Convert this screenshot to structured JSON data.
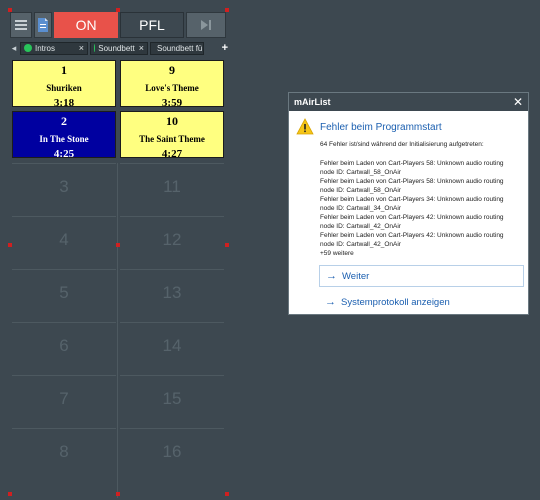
{
  "toolbar": {
    "on_label": "ON",
    "pfl_label": "PFL"
  },
  "tabs": [
    {
      "label": "Intros",
      "close": "×"
    },
    {
      "label": "Soundbett",
      "close": "×"
    },
    {
      "label": "Soundbett fü",
      "close": ""
    }
  ],
  "tab_add": "+",
  "tab_prev": "◂",
  "carts": [
    {
      "number": "1",
      "title": "Shuriken",
      "duration": "3:18",
      "color": "#ffff80"
    },
    {
      "number": "9",
      "title": "Love's Theme",
      "duration": "3:59",
      "color": "#ffff80"
    },
    {
      "number": "2",
      "title": "In The Stone",
      "duration": "4:25",
      "color": "#0000a0"
    },
    {
      "number": "10",
      "title": "The Saint Theme",
      "duration": "4:27",
      "color": "#ffff80"
    }
  ],
  "empty_slots": [
    "3",
    "11",
    "4",
    "12",
    "5",
    "13",
    "6",
    "14",
    "7",
    "15",
    "8",
    "16"
  ],
  "dialog": {
    "window_title": "mAirList",
    "close": "✕",
    "heading": "Fehler beim Programmstart",
    "summary": "64 Fehler ist/sind während der Initialisierung aufgetreten:",
    "details": [
      "Fehler beim Laden von Cart-Players 58: Unknown audio routing",
      "node ID: Cartwall_58_OnAir",
      "Fehler beim Laden von Cart-Players 58: Unknown audio routing",
      "node ID: Cartwall_58_OnAir",
      "Fehler beim Laden von Cart-Players 34: Unknown audio routing",
      "node ID: Cartwall_34_OnAir",
      "Fehler beim Laden von Cart-Players 42: Unknown audio routing",
      "node ID: Cartwall_42_OnAir",
      "Fehler beim Laden von Cart-Players 42: Unknown audio routing",
      "node ID: Cartwall_42_OnAir",
      "+59 weitere"
    ],
    "commands": [
      {
        "label": "Weiter",
        "arrow": "→"
      },
      {
        "label": "Systemprotokoll anzeigen",
        "arrow": "→"
      }
    ]
  },
  "colors": {
    "on": "#e8524a",
    "background": "#3d4850",
    "link": "#1b5fb0"
  }
}
